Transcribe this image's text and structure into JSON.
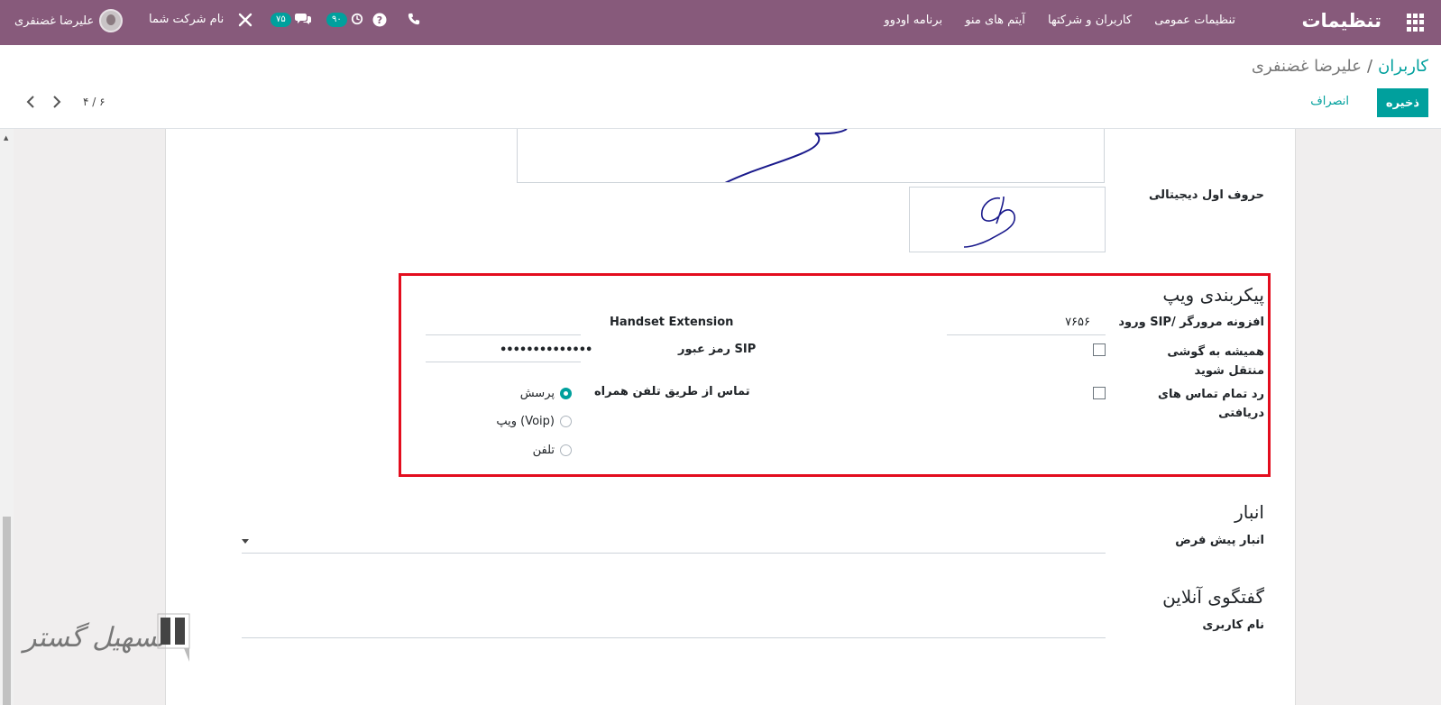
{
  "navbar": {
    "brand": "تنظیمات",
    "menu": [
      "تنظیمات عمومی",
      "کاربران و شرکتها",
      "آیتم های منو",
      "برنامه اودوو"
    ],
    "phone_icon": "phone-icon",
    "help_icon": "question-circle-icon",
    "activity_badge": "۹۰",
    "messages_badge": "۷۵",
    "company_name": "نام شرکت شما",
    "user_name": "علیرضا غضنفری"
  },
  "breadcrumb": {
    "parent": "کاربران",
    "separator": "/",
    "current": "علیرضا غضنفری"
  },
  "buttons": {
    "save": "ذخیره",
    "discard": "انصراف"
  },
  "pager": {
    "value": "۴ / ۶"
  },
  "form": {
    "digital_initials_label": "حروف اول دیجیتالی",
    "voip": {
      "title": "پیکربندی ویپ",
      "sip_login_label": "ورود SIP/ افزونه مرورگر",
      "sip_login_value": "۷۶۵۶",
      "handset_label": "Handset Extension",
      "handset_value": "",
      "always_transfer_label": "همیشه به گوشی منتقل شوید",
      "always_transfer_checked": false,
      "sip_password_label": "رمز عبور SIP",
      "sip_password_value": "••••••••••••••",
      "reject_all_label": "رد تمام تماس های دریافتی",
      "reject_all_checked": false,
      "mobile_call_label": "تماس از طریق تلفن همراه",
      "mobile_call_options": [
        "پرسش",
        "ویپ (Voip)",
        "تلفن"
      ],
      "mobile_call_selected": "پرسش"
    },
    "inventory": {
      "title": "انبار",
      "default_warehouse_label": "انبار پیش فرض",
      "default_warehouse_value": ""
    },
    "livechat": {
      "title": "گفتگوی آنلاین",
      "username_label": "نام کاربری",
      "username_value": ""
    }
  },
  "watermark": {
    "text": "تسهیل گستر"
  },
  "colors": {
    "navbar": "#875a7b",
    "accent": "#00a09d",
    "highlight_box": "#e30d1e"
  }
}
